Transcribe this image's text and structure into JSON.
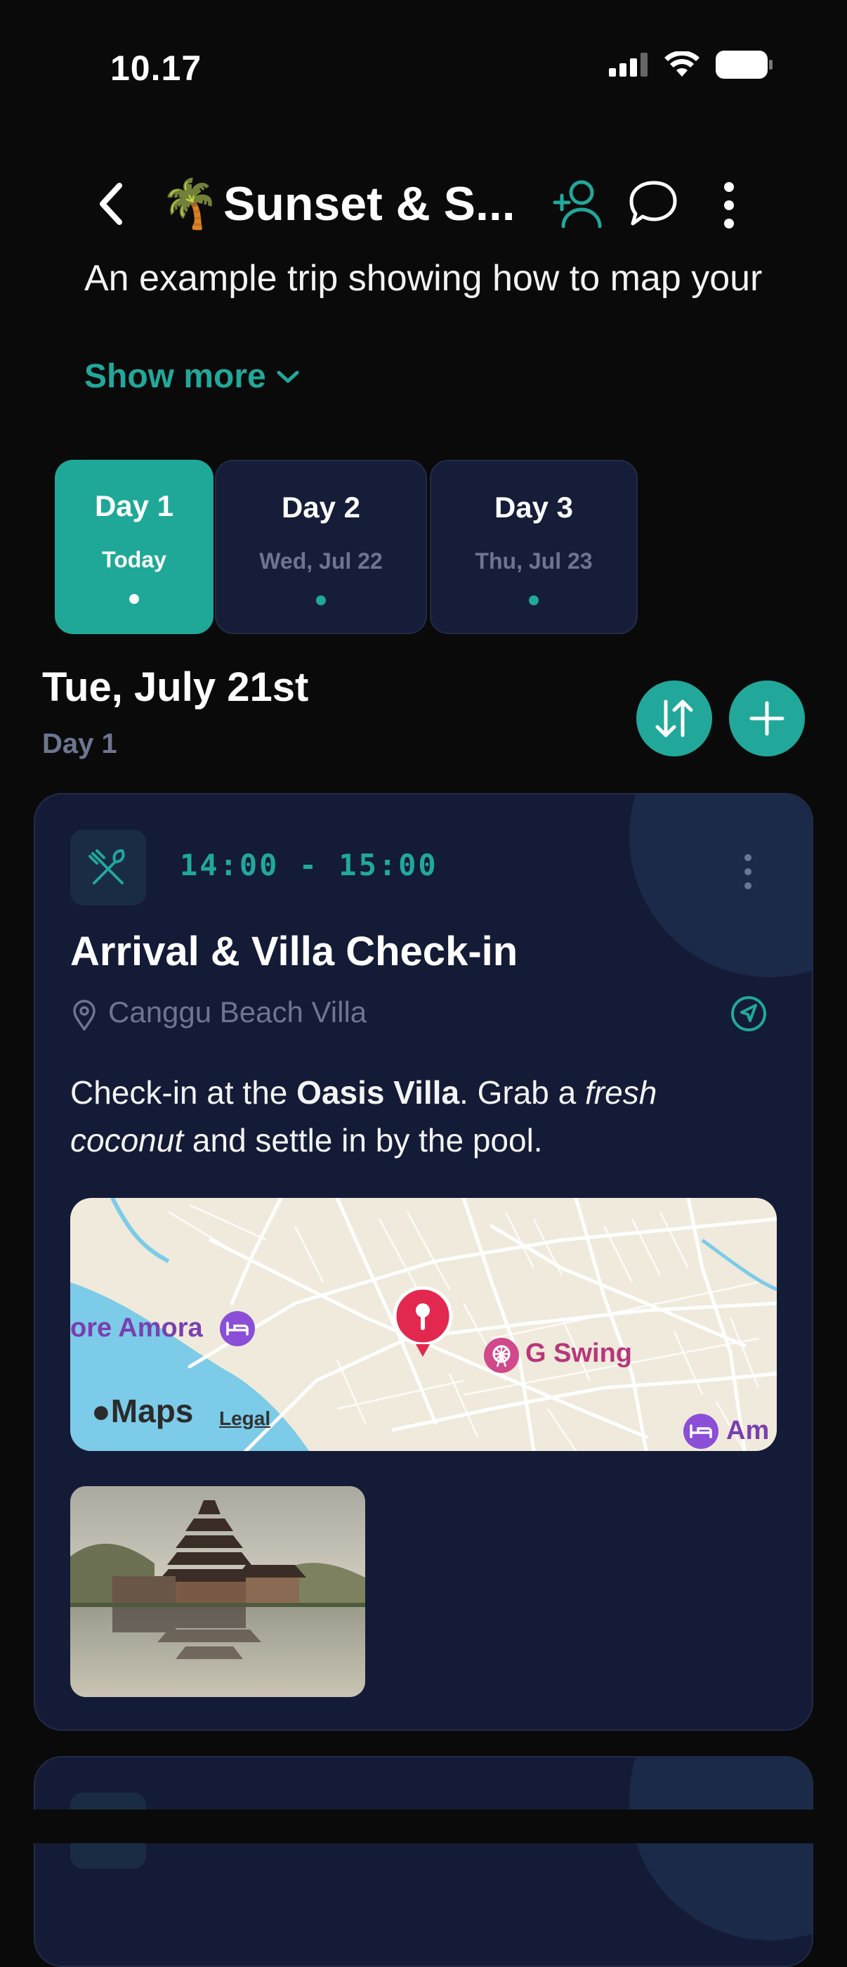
{
  "status_bar": {
    "time": "10.17"
  },
  "header": {
    "emoji": "🌴",
    "title": "Sunset & S...",
    "subtitle": "An example trip showing how to map your days",
    "show_more": "Show more"
  },
  "days": [
    {
      "label": "Day 1",
      "date": "Today",
      "selected": true
    },
    {
      "label": "Day 2",
      "date": "Wed, Jul 22",
      "selected": false
    },
    {
      "label": "Day 3",
      "date": "Thu, Jul 23",
      "selected": false
    }
  ],
  "day_header": {
    "date": "Tue, July 21st",
    "day": "Day 1"
  },
  "event": {
    "category_icon": "utensils-icon",
    "time": "14:00 - 15:00",
    "title": "Arrival & Villa Check-in",
    "location": "Canggu Beach Villa",
    "description": {
      "p1": "Check-in at the ",
      "b1": "Oasis Villa",
      "p2": ". Grab a ",
      "i1": "fresh coconut",
      "p3": " and settle in by the pool."
    },
    "map": {
      "label_left": "ore Amora",
      "label_center": "G Swing",
      "label_right": "Am",
      "logo": "Maps",
      "legal": "Legal"
    }
  },
  "colors": {
    "accent": "#21a89a",
    "card": "#141b36",
    "muted": "#6d7690"
  }
}
